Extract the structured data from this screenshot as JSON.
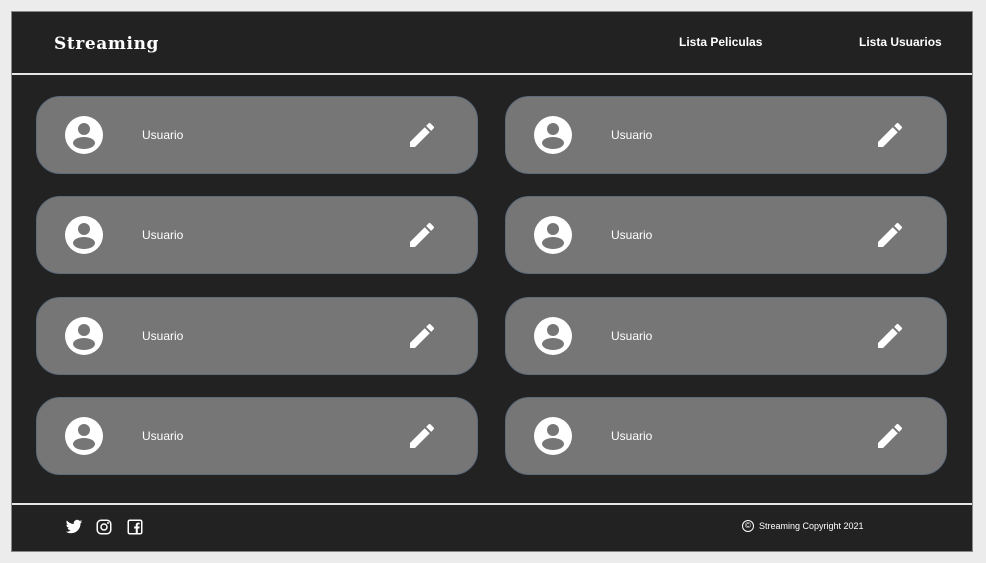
{
  "header": {
    "brand": "Streaming",
    "nav": [
      "Lista Peliculas",
      "Lista Usuarios"
    ]
  },
  "users": [
    {
      "label": "Usuario"
    },
    {
      "label": "Usuario"
    },
    {
      "label": "Usuario"
    },
    {
      "label": "Usuario"
    },
    {
      "label": "Usuario"
    },
    {
      "label": "Usuario"
    },
    {
      "label": "Usuario"
    },
    {
      "label": "Usuario"
    }
  ],
  "footer": {
    "social_icons": [
      "twitter-icon",
      "instagram-icon",
      "facebook-icon"
    ],
    "copyright_symbol": "©",
    "copyright": "Streaming Copyright 2021"
  },
  "colors": {
    "background": "#222222",
    "card": "#767676",
    "text": "#ffffff"
  }
}
